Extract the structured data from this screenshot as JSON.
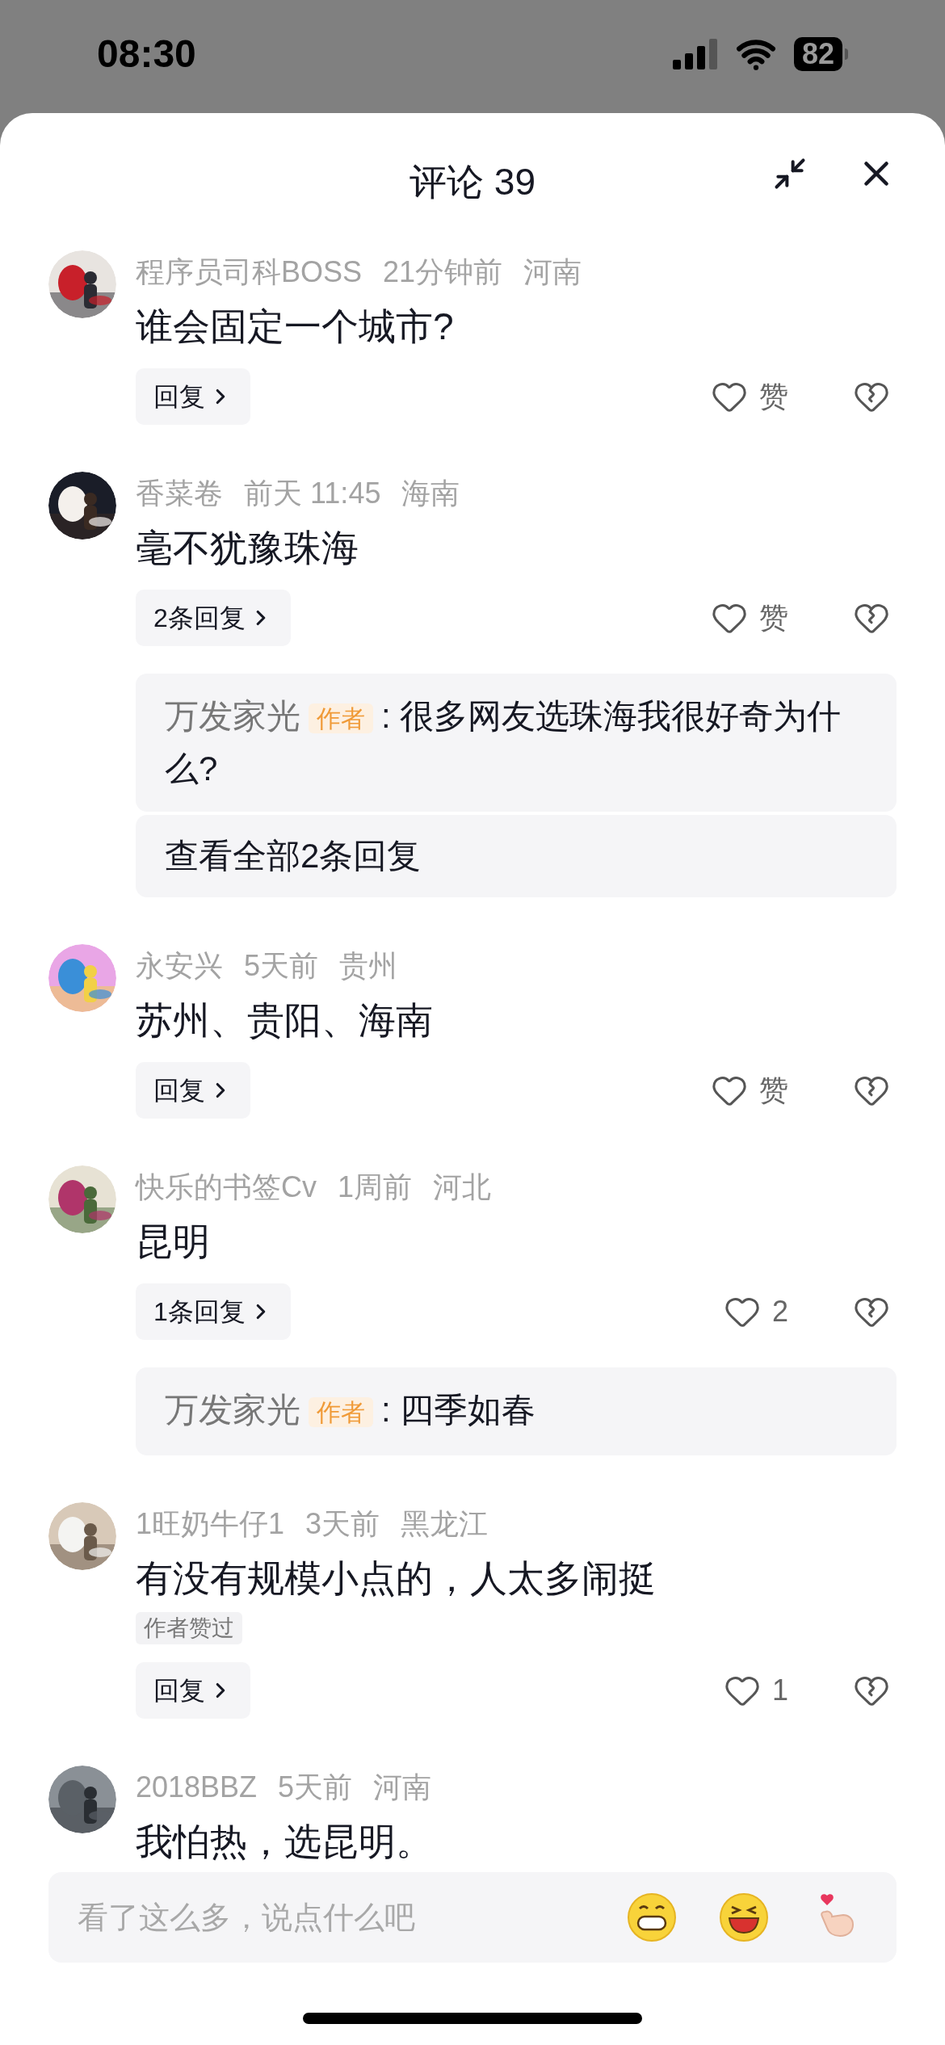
{
  "status_bar": {
    "time": "08:30",
    "battery": "82"
  },
  "header": {
    "title": "评论 39"
  },
  "comments": [
    {
      "name": "程序员司科BOSS",
      "time": "21分钟前",
      "region": "河南",
      "text": "谁会固定一个城市?",
      "reply_button": "回复",
      "likes": "赞"
    },
    {
      "name": "香菜卷",
      "time": "前天 11:45",
      "region": "海南",
      "text": "毫不犹豫珠海",
      "reply_button": "2条回复",
      "likes": "赞",
      "replies": [
        {
          "author": "万发家光",
          "badge": "作者",
          "text": ": 很多网友选珠海我很好奇为什么?"
        }
      ],
      "view_all": "查看全部2条回复"
    },
    {
      "name": "永安兴",
      "time": "5天前",
      "region": "贵州",
      "text": "苏州、贵阳、海南",
      "reply_button": "回复",
      "likes": "赞"
    },
    {
      "name": "快乐的书签Cv",
      "time": "1周前",
      "region": "河北",
      "text": "昆明",
      "reply_button": "1条回复",
      "likes": "2",
      "replies": [
        {
          "author": "万发家光",
          "badge": "作者",
          "text": ": 四季如春"
        }
      ]
    },
    {
      "name": "1旺奶牛仔1",
      "time": "3天前",
      "region": "黑龙江",
      "text": "有没有规模小点的，人太多闹挺",
      "tag": "作者赞过",
      "reply_button": "回复",
      "likes": "1"
    },
    {
      "name": "2018BBZ",
      "time": "5天前",
      "region": "河南",
      "text": "我怕热，选昆明。"
    }
  ],
  "input": {
    "placeholder": "看了这么多，说点什么吧"
  }
}
